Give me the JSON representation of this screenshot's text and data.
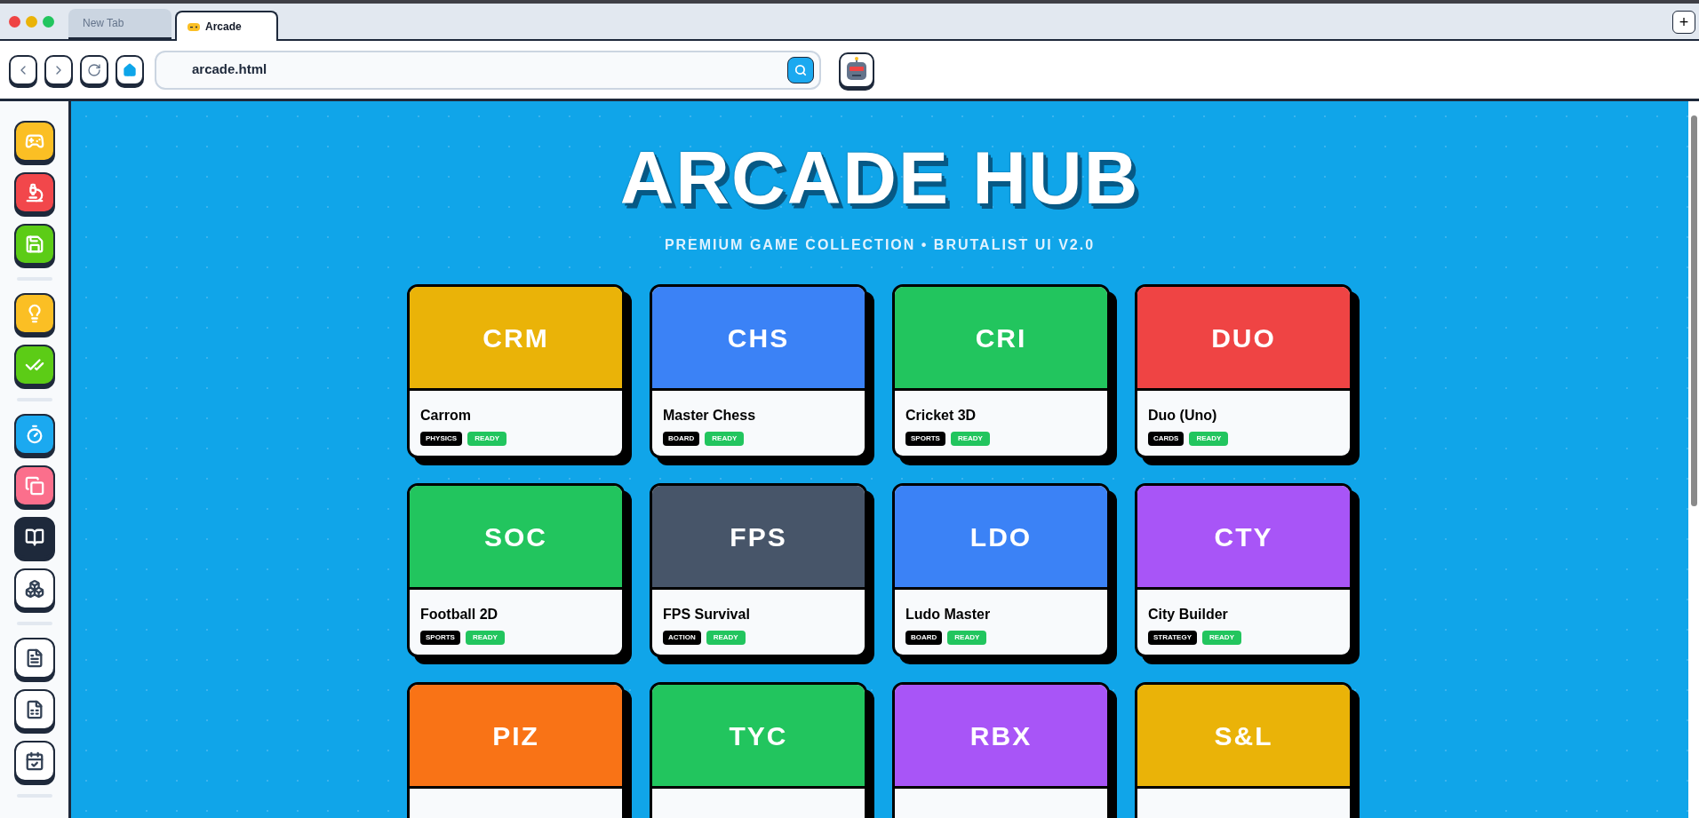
{
  "browser": {
    "tabs": [
      {
        "label": "New Tab",
        "selected": false
      },
      {
        "label": "Arcade",
        "selected": true
      }
    ],
    "address": "arcade.html",
    "new_tab": "+"
  },
  "sidebar": {
    "groups": [
      {
        "items": [
          {
            "color": "#fbbf24"
          },
          {
            "color": "#f2474b"
          },
          {
            "color": "#5ccc16"
          }
        ]
      },
      {
        "items": [
          {
            "color": "#fbbf24"
          },
          {
            "color": "#5ccc16"
          }
        ]
      },
      {
        "items": [
          {
            "color": "#1ba9f0"
          },
          {
            "color": "#fb6f8c"
          },
          {
            "color": "#1e293b"
          },
          {
            "color": "#ffffff"
          }
        ]
      },
      {
        "items": [
          {
            "color": "#ffffff"
          },
          {
            "color": "#ffffff"
          },
          {
            "color": "#ffffff"
          }
        ]
      }
    ]
  },
  "hero": {
    "title": "ARCADE HUB",
    "subtitle": "PREMIUM GAME COLLECTION • BRUTALIST UI V2.0"
  },
  "games": [
    {
      "code": "CRM",
      "color": "#eab308",
      "title": "Carrom",
      "tags": [
        {
          "label": "PHYSICS",
          "kind": "category"
        },
        {
          "label": "READY",
          "kind": "status"
        }
      ]
    },
    {
      "code": "CHS",
      "color": "#3b82f6",
      "title": "Master Chess",
      "tags": [
        {
          "label": "BOARD",
          "kind": "category"
        },
        {
          "label": "READY",
          "kind": "status"
        }
      ]
    },
    {
      "code": "CRI",
      "color": "#22c55e",
      "title": "Cricket 3D",
      "tags": [
        {
          "label": "SPORTS",
          "kind": "category"
        },
        {
          "label": "READY",
          "kind": "status"
        }
      ]
    },
    {
      "code": "DUO",
      "color": "#ef4444",
      "title": "Duo (Uno)",
      "tags": [
        {
          "label": "CARDS",
          "kind": "category"
        },
        {
          "label": "READY",
          "kind": "status"
        }
      ]
    },
    {
      "code": "SOC",
      "color": "#22c55e",
      "title": "Football 2D",
      "tags": [
        {
          "label": "SPORTS",
          "kind": "category"
        },
        {
          "label": "READY",
          "kind": "status"
        }
      ]
    },
    {
      "code": "FPS",
      "color": "#475569",
      "title": "FPS Survival",
      "tags": [
        {
          "label": "ACTION",
          "kind": "category"
        },
        {
          "label": "READY",
          "kind": "status"
        }
      ]
    },
    {
      "code": "LDO",
      "color": "#3b82f6",
      "title": "Ludo Master",
      "tags": [
        {
          "label": "BOARD",
          "kind": "category"
        },
        {
          "label": "READY",
          "kind": "status"
        }
      ]
    },
    {
      "code": "CTY",
      "color": "#a855f7",
      "title": "City Builder",
      "tags": [
        {
          "label": "STRATEGY",
          "kind": "category"
        },
        {
          "label": "READY",
          "kind": "status"
        }
      ]
    },
    {
      "code": "PIZ",
      "color": "#f97316"
    },
    {
      "code": "TYC",
      "color": "#22c55e"
    },
    {
      "code": "RBX",
      "color": "#a855f7"
    },
    {
      "code": "S&L",
      "color": "#eab308"
    }
  ]
}
